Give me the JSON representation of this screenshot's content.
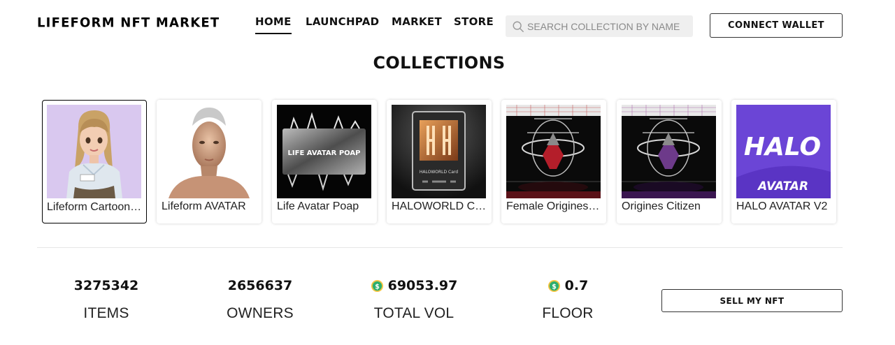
{
  "header": {
    "logo": "LIFEFORM NFT MARKET",
    "nav": [
      {
        "label": "HOME",
        "active": true
      },
      {
        "label": "LAUNCHPAD",
        "active": false
      },
      {
        "label": "MARKET",
        "active": false
      },
      {
        "label": "STORE",
        "active": false
      }
    ],
    "search": {
      "placeholder": "SEARCH COLLECTION BY NAME",
      "value": ""
    },
    "connect_label": "CONNECT WALLET"
  },
  "collections": {
    "title": "COLLECTIONS",
    "items": [
      {
        "label": "Lifeform Cartoon Avatar",
        "selected": true,
        "image": "cartoon-avatar-girl"
      },
      {
        "label": "Lifeform AVATAR",
        "selected": false,
        "image": "realistic-avatar-woman"
      },
      {
        "label": "Life Avatar Poap",
        "selected": false,
        "image": "silver-card-poap"
      },
      {
        "label": "HALOWORLD CARD",
        "selected": false,
        "image": "haloworld-card"
      },
      {
        "label": "Female Origines Citizen",
        "selected": false,
        "image": "origines-red-chamber"
      },
      {
        "label": "Origines Citizen",
        "selected": false,
        "image": "origines-purple-chamber"
      },
      {
        "label": "HALO AVATAR V2",
        "selected": false,
        "image": "halo-avatar-logo"
      }
    ],
    "halo_logo": {
      "top": "HALO",
      "bottom": "AVATAR"
    },
    "poap_text": "LIFE AVATAR POAP",
    "haloworld_card_text": "HALOWORLD Card"
  },
  "stats": [
    {
      "value": "3275342",
      "label": "ITEMS",
      "icon": null
    },
    {
      "value": "2656637",
      "label": "OWNERS",
      "icon": null
    },
    {
      "value": "69053.97",
      "label": "TOTAL VOL",
      "icon": "coin-icon"
    },
    {
      "value": "0.7",
      "label": "FLOOR",
      "icon": "coin-icon"
    }
  ],
  "sell_label": "SELL MY NFT",
  "colors": {
    "accent": "#111111",
    "coin": "#2eae6e",
    "halo_purple": "#6b45d6"
  }
}
